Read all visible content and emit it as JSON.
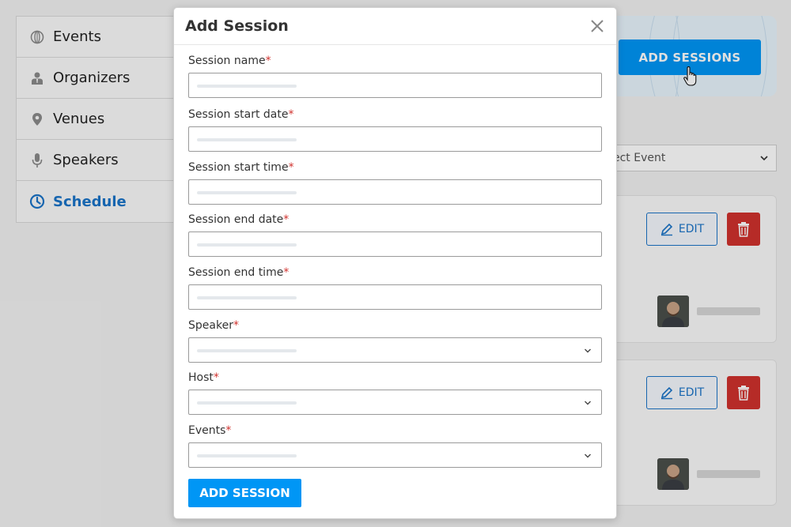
{
  "sidebar": {
    "items": [
      {
        "label": "Events",
        "icon": "globe-icon"
      },
      {
        "label": "Organizers",
        "icon": "person-icon"
      },
      {
        "label": "Venues",
        "icon": "location-pin-icon"
      },
      {
        "label": "Speakers",
        "icon": "microphone-icon"
      },
      {
        "label": "Schedule",
        "icon": "clock-icon",
        "active": true
      }
    ]
  },
  "header": {
    "add_sessions_label": "ADD SESSIONS"
  },
  "filter": {
    "select_event_value": "ect Event"
  },
  "cards": [
    {
      "edit_label": "EDIT"
    },
    {
      "edit_label": "EDIT"
    }
  ],
  "modal": {
    "title": "Add Session",
    "fields": [
      {
        "label": "Session name",
        "required": "*",
        "type": "text"
      },
      {
        "label": "Session start date",
        "required": "*",
        "type": "text"
      },
      {
        "label": "Session start time",
        "required": "*",
        "type": "text"
      },
      {
        "label": "Session end date",
        "required": "*",
        "type": "text"
      },
      {
        "label": "Session end time",
        "required": "*",
        "type": "text"
      },
      {
        "label": "Speaker",
        "required": "*",
        "type": "select"
      },
      {
        "label": "Host",
        "required": "*",
        "type": "select"
      },
      {
        "label": "Events",
        "required": "*",
        "type": "select"
      }
    ],
    "submit_label": "ADD SESSION"
  },
  "colors": {
    "primary": "#0096f5",
    "active_nav": "#1a73c8",
    "danger": "#d0312d",
    "required": "#d0312d"
  }
}
